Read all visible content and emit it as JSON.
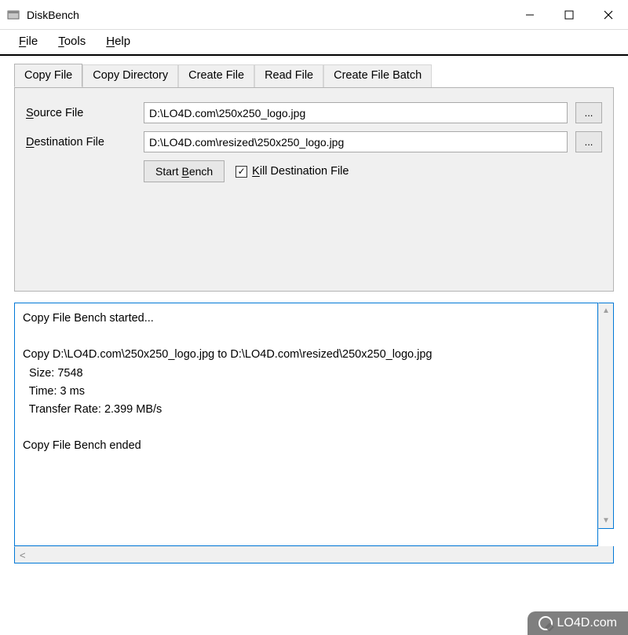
{
  "window": {
    "title": "DiskBench"
  },
  "menu": {
    "file": "File",
    "tools": "Tools",
    "help": "Help"
  },
  "tabs": {
    "copy_file": "Copy File",
    "copy_directory": "Copy Directory",
    "create_file": "Create File",
    "read_file": "Read File",
    "create_file_batch": "Create File Batch"
  },
  "form": {
    "source_label": "Source File",
    "source_value": "D:\\LO4D.com\\250x250_logo.jpg",
    "dest_label": "Destination File",
    "dest_value": "D:\\LO4D.com\\resized\\250x250_logo.jpg",
    "browse": "...",
    "start_bench": "Start Bench",
    "kill_dest": "Kill Destination File",
    "kill_dest_checked": true
  },
  "output": {
    "line1": "Copy File Bench started...",
    "line2": "Copy D:\\LO4D.com\\250x250_logo.jpg to D:\\LO4D.com\\resized\\250x250_logo.jpg",
    "line3": "  Size: 7548",
    "line4": "  Time: 3 ms",
    "line5": "  Transfer Rate: 2.399 MB/s",
    "line6": "Copy File Bench ended"
  },
  "watermark": {
    "text": "LO4D.com"
  }
}
